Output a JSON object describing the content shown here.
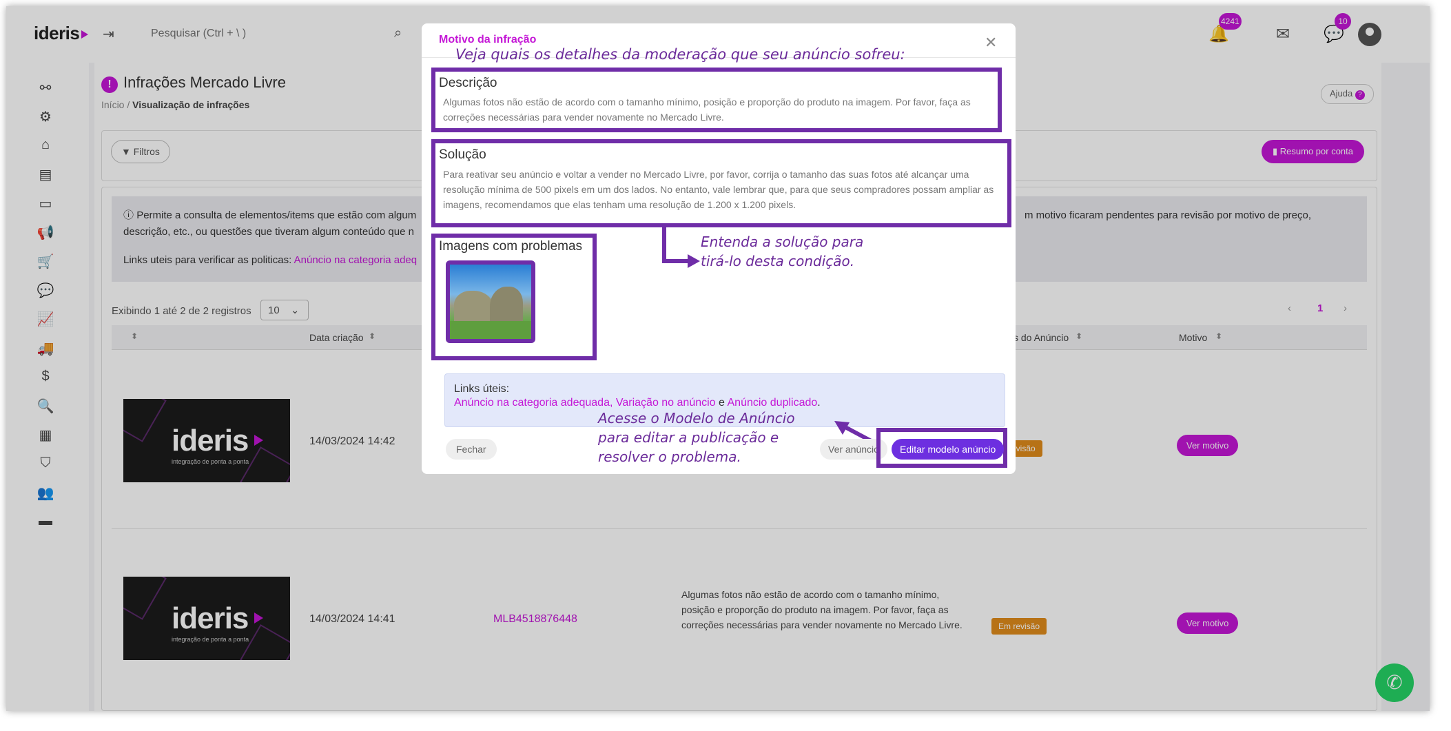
{
  "app": {
    "logo": "ideris",
    "search_placeholder": "Pesquisar (Ctrl + \\ )",
    "notifications_count": "4241",
    "messages_count": "10"
  },
  "page": {
    "title": "Infrações Mercado Livre",
    "breadcrumb_home": "Início",
    "breadcrumb_sep": "/",
    "breadcrumb_current": "Visualização de infrações",
    "help_label": "Ajuda",
    "filters_label": "Filtros",
    "summary_label": "Resumo por conta"
  },
  "info": {
    "text_left": "Permite a consulta de elementos/items que estão com algum descrição, etc., ou questões que tiveram algum conteúdo que n",
    "text_right": "m motivo ficaram pendentes para revisão por motivo de preço,",
    "links_label": "Links uteis para verificar as politicas:",
    "links_value": "Anúncio na categoria adeq"
  },
  "table": {
    "showing": "Exibindo 1 até 2 de 2 registros",
    "page_size": "10",
    "current_page": "1",
    "headers": {
      "created": "Data criação",
      "ad_status": "s do Anúncio",
      "reason": "Motivo"
    },
    "rows": [
      {
        "date": "14/03/2024 14:42",
        "status": "revisão",
        "action": "Ver motivo"
      },
      {
        "date": "14/03/2024 14:41",
        "ad_id": "MLB4518876448",
        "description": "Algumas fotos não estão de acordo com o tamanho mínimo, posição e proporção do produto na imagem. Por favor, faça as correções necessárias para vender novamente no Mercado Livre.",
        "status": "Em revisão",
        "action": "Ver motivo"
      }
    ],
    "thumb_logo": "ideris",
    "thumb_sub": "integração de ponta a ponta"
  },
  "modal": {
    "title": "Motivo da infração",
    "description_title": "Descrição",
    "description_text": "Algumas fotos não estão de acordo com o tamanho mínimo, posição e proporção do produto na imagem. Por favor, faça as correções necessárias para vender novamente no Mercado Livre.",
    "solution_title": "Solução",
    "solution_text": "Para reativar seu anúncio e voltar a vender no Mercado Livre, por favor, corrija o tamanho das suas fotos até alcançar uma resolução mínima de 500 pixels em um dos lados. No entanto, vale lembrar que, para que seus compradores possam ampliar as imagens, recomendamos que elas tenham uma resolução de 1.200 x 1.200 pixels.",
    "images_title": "Imagens com problemas",
    "useful_title": "Links úteis:",
    "useful_link1": "Anúncio na categoria adequada",
    "useful_sep1": ",",
    "useful_link2": "Variação no anúncio",
    "useful_sep2": "e",
    "useful_link3": "Anúncio duplicado",
    "useful_end": ".",
    "close_label": "Fechar",
    "view_ad_label": "Ver anúncio",
    "edit_model_label": "Editar modelo anúncio"
  },
  "annotations": {
    "top": "Veja quais os detalhes da moderação que seu anúncio sofreu:",
    "solution": "Entenda a solução para tirá-lo desta condição.",
    "edit": "Acesse o Modelo de Anúncio para editar a publicação e resolver o problema."
  },
  "colors": {
    "brand": "#c417d6",
    "annotation": "#6f2da8",
    "edit_button": "#6d2fe0"
  }
}
